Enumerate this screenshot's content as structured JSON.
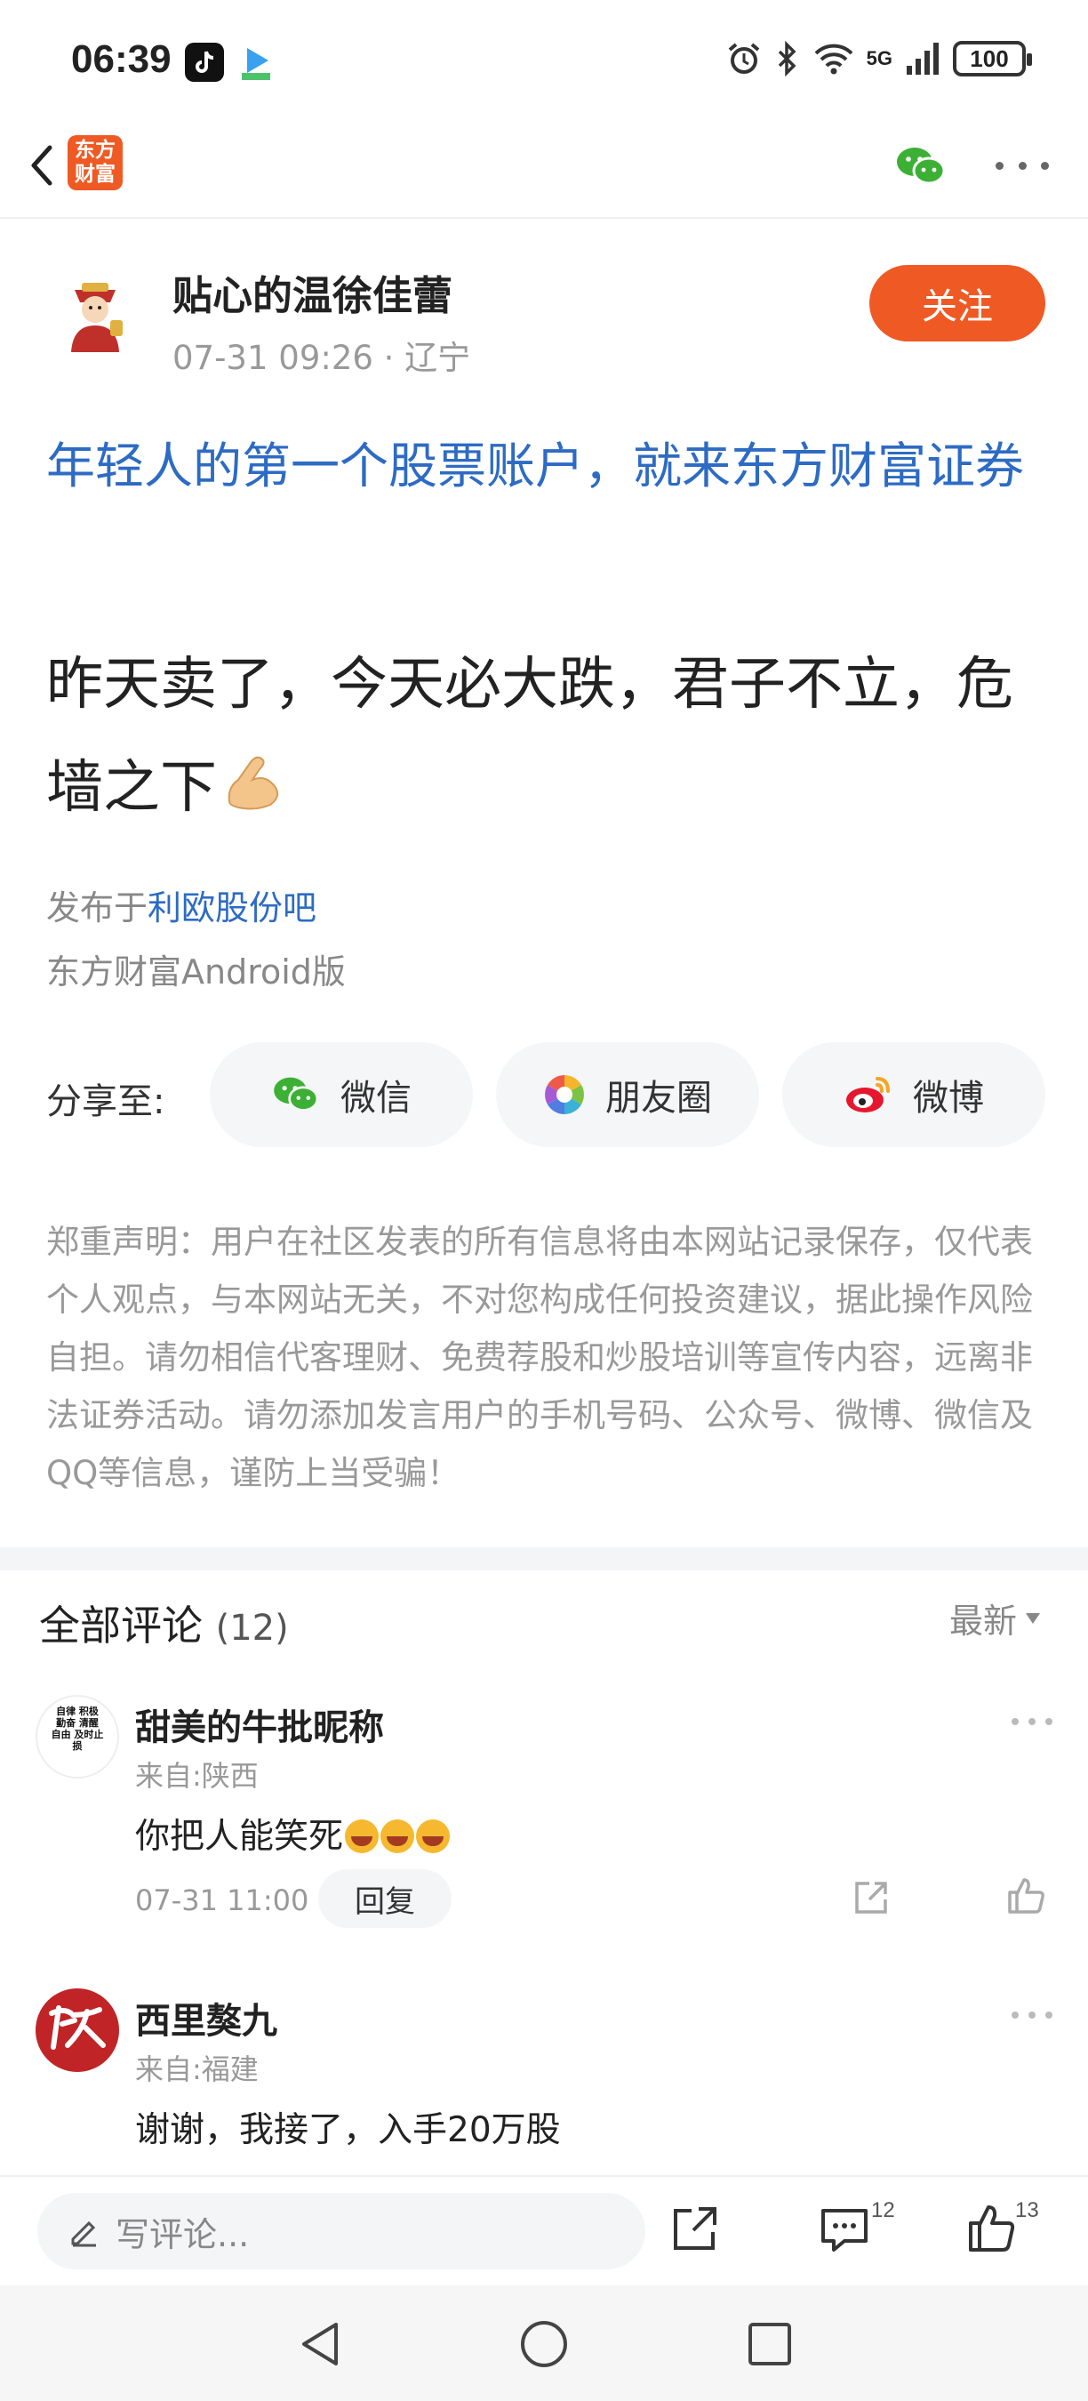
{
  "status_bar": {
    "time": "06:39",
    "network": "5G",
    "battery": "100"
  },
  "nav": {
    "app_logo_text": "东方财富"
  },
  "author": {
    "name": "贴心的温徐佳蕾",
    "meta": "07-31 09:26 · 辽宁",
    "follow_label": "关注"
  },
  "post": {
    "ad_text": "年轻人的第一个股票账户，就来东方财富证券",
    "body": "昨天卖了，今天必大跌，君子不立，危墙之下",
    "posted_prefix": "发布于",
    "bar_name": "利欧股份吧",
    "client": "东方财富Android版"
  },
  "share": {
    "label": "分享至:",
    "wechat": "微信",
    "moments": "朋友圈",
    "weibo": "微博"
  },
  "disclaimer": "郑重声明：用户在社区发表的所有信息将由本网站记录保存，仅代表个人观点，与本网站无关，不对您构成任何投资建议，据此操作风险自担。请勿相信代客理财、免费荐股和炒股培训等宣传内容，远离非法证券活动。请勿添加发言用户的手机号码、公众号、微博、微信及QQ等信息，谨防上当受骗！",
  "comments": {
    "title": "全部评论",
    "count": "(12)",
    "sort": "最新",
    "items": [
      {
        "name": "甜美的牛批昵称",
        "location": "来自:陕西",
        "text": "你把人能笑死",
        "time": "07-31 11:00",
        "reply": "回复",
        "avatar_text": "自律 积极 勤奋 清醒 自由 及时止损"
      },
      {
        "name": "西里獒九",
        "location": "来自:福建",
        "text": "谢谢，我接了，入手20万股"
      }
    ]
  },
  "bottom_bar": {
    "placeholder": "写评论...",
    "comment_count": "12",
    "like_count": "13"
  },
  "colors": {
    "accent": "#ef5a24",
    "link": "#2d6bc4",
    "wechat": "#3cb034"
  }
}
